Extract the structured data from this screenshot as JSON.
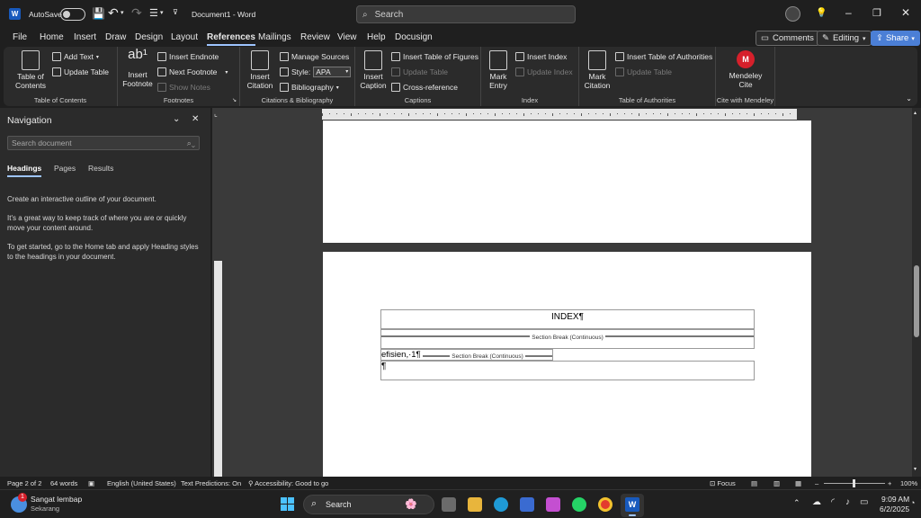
{
  "titlebar": {
    "autosave_label": "AutoSave",
    "doc_title": "Document1 - Word",
    "search_placeholder": "Search"
  },
  "menu": {
    "tabs": [
      "File",
      "Home",
      "Insert",
      "Draw",
      "Design",
      "Layout",
      "References",
      "Mailings",
      "Review",
      "View",
      "Help",
      "Docusign"
    ],
    "active": "References",
    "comments": "Comments",
    "editing": "Editing",
    "share": "Share"
  },
  "ribbon": {
    "toc": {
      "big": "Table of Contents",
      "add_text": "Add Text",
      "update_table": "Update Table",
      "label": "Table of Contents"
    },
    "footnotes": {
      "big": "Insert Footnote",
      "insert_endnote": "Insert Endnote",
      "next_footnote": "Next Footnote",
      "show_notes": "Show Notes",
      "label": "Footnotes"
    },
    "citations": {
      "big": "Insert Citation",
      "manage_sources": "Manage Sources",
      "style_label": "Style:",
      "style_value": "APA",
      "bibliography": "Bibliography",
      "label": "Citations & Bibliography"
    },
    "captions": {
      "big": "Insert Caption",
      "insert_tof": "Insert Table of Figures",
      "update_table": "Update Table",
      "cross_reference": "Cross-reference",
      "label": "Captions"
    },
    "index": {
      "big": "Mark Entry",
      "insert_index": "Insert Index",
      "update_index": "Update Index",
      "label": "Index"
    },
    "toa": {
      "big": "Mark Citation",
      "insert_toa": "Insert Table of Authorities",
      "update_table": "Update Table",
      "label": "Table of Authorities"
    },
    "mendeley": {
      "big": "Mendeley Cite",
      "label": "Cite with Mendeley"
    }
  },
  "nav": {
    "title": "Navigation",
    "search_placeholder": "Search document",
    "tabs": [
      "Headings",
      "Pages",
      "Results"
    ],
    "p1": "Create an interactive outline of your document.",
    "p2": "It's a great way to keep track of where you are or quickly move your content around.",
    "p3": "To get started, go to the Home tab and apply Heading styles to the headings in your document."
  },
  "document": {
    "index_heading": "INDEX¶",
    "section_break_1": "Section Break (Continuous)",
    "entry_text": "efisien,·1¶",
    "section_break_2": "Section Break (Continuous)",
    "para_mark": "¶"
  },
  "status": {
    "page": "Page 2 of 2",
    "words": "64 words",
    "language": "English (United States)",
    "predictions": "Text Predictions: On",
    "accessibility": "Accessibility: Good to go",
    "focus": "Focus",
    "zoom": "100%"
  },
  "taskbar": {
    "weather_title": "Sangat lembap",
    "weather_sub": "Sekarang",
    "weather_badge": "1",
    "search": "Search",
    "time": "9:09 AM",
    "date": "6/2/2025"
  },
  "colors": {
    "accent": "#9ec5ff",
    "word_blue": "#185abd",
    "mendeley_red": "#d6202b"
  }
}
